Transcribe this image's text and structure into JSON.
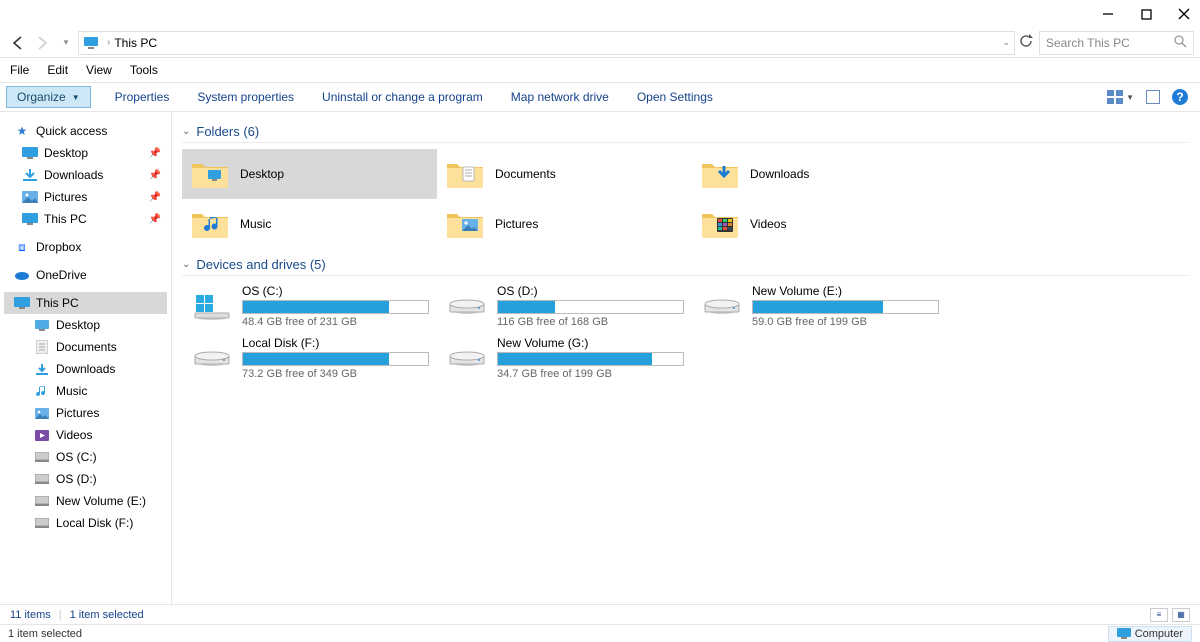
{
  "window_controls": {
    "min": "–",
    "max": "▢",
    "close": "✕"
  },
  "breadcrumb": {
    "location": "This PC"
  },
  "search": {
    "placeholder": "Search This PC"
  },
  "menubar": [
    "File",
    "Edit",
    "View",
    "Tools"
  ],
  "toolbar": {
    "organize": "Organize",
    "links": [
      "Properties",
      "System properties",
      "Uninstall or change a program",
      "Map network drive",
      "Open Settings"
    ]
  },
  "sidebar": {
    "quick_access": {
      "label": "Quick access",
      "items": [
        "Desktop",
        "Downloads",
        "Pictures",
        "This PC"
      ]
    },
    "dropbox": "Dropbox",
    "onedrive": "OneDrive",
    "thispc": {
      "label": "This PC",
      "items": [
        "Desktop",
        "Documents",
        "Downloads",
        "Music",
        "Pictures",
        "Videos",
        "OS (C:)",
        "OS (D:)",
        "New Volume (E:)",
        "Local Disk (F:)"
      ]
    }
  },
  "sections": {
    "folders": {
      "title": "Folders (6)",
      "items": [
        {
          "name": "Desktop",
          "icon": "desktop"
        },
        {
          "name": "Documents",
          "icon": "documents"
        },
        {
          "name": "Downloads",
          "icon": "downloads"
        },
        {
          "name": "Music",
          "icon": "music"
        },
        {
          "name": "Pictures",
          "icon": "pictures"
        },
        {
          "name": "Videos",
          "icon": "videos"
        }
      ]
    },
    "drives": {
      "title": "Devices and drives (5)",
      "items": [
        {
          "name": "OS (C:)",
          "free": "48.4 GB free of 231 GB",
          "fill": 79,
          "icon": "win"
        },
        {
          "name": "OS (D:)",
          "free": "116 GB free of 168 GB",
          "fill": 31,
          "icon": "hdd"
        },
        {
          "name": "New Volume (E:)",
          "free": "59.0 GB free of 199 GB",
          "fill": 70,
          "icon": "hdd"
        },
        {
          "name": "Local Disk (F:)",
          "free": "73.2 GB free of 349 GB",
          "fill": 79,
          "icon": "hdd"
        },
        {
          "name": "New Volume (G:)",
          "free": "34.7 GB free of 199 GB",
          "fill": 83,
          "icon": "hdd"
        }
      ]
    }
  },
  "status": {
    "items": "11 items",
    "selected": "1 item selected"
  },
  "footer": {
    "left": "1 item selected",
    "right": "Computer"
  }
}
